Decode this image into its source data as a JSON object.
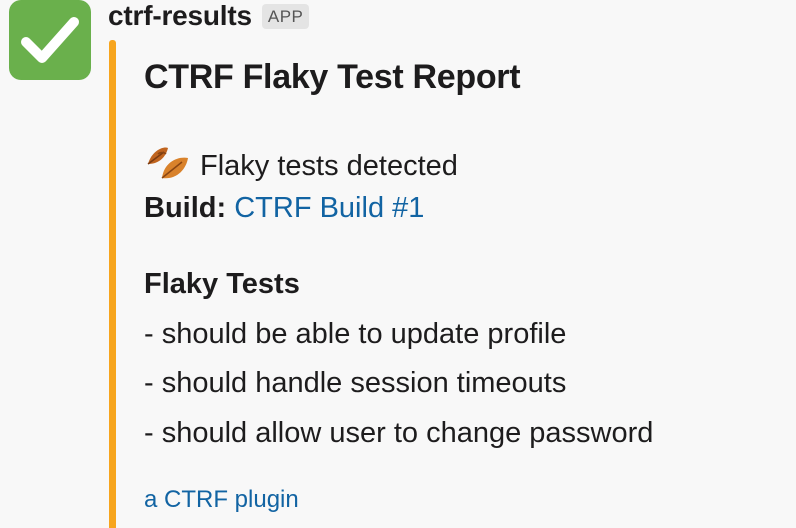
{
  "message": {
    "sender": "ctrf-results",
    "badge": "APP",
    "avatar_icon": "check-mark-icon",
    "avatar_color": "#6ab04c",
    "accent_color": "#f7a51e",
    "link_color": "#1264a3"
  },
  "report": {
    "title": "CTRF Flaky Test Report",
    "status_icon": "fallen-leaf-icon",
    "status_text": "Flaky tests detected",
    "build_label": "Build:",
    "build_link": "CTRF Build #1",
    "section_title": "Flaky Tests",
    "tests": [
      "- should be able to update profile",
      "- should handle session timeouts",
      "- should allow user to change password"
    ],
    "footer_link": "a CTRF plugin"
  }
}
